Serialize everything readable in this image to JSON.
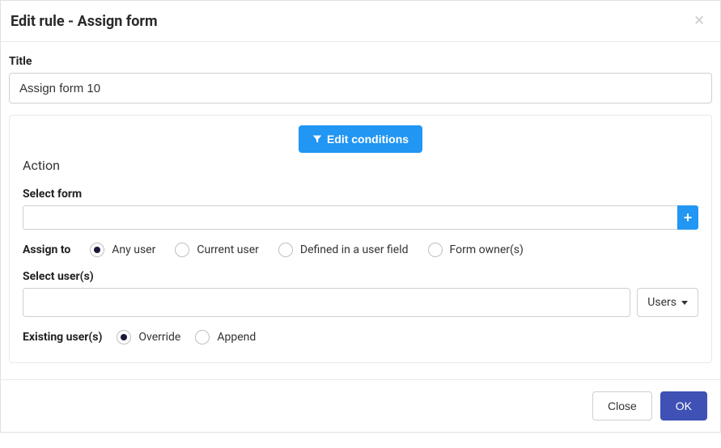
{
  "header": {
    "title": "Edit rule - Assign form"
  },
  "form": {
    "title_label": "Title",
    "title_value": "Assign form 10"
  },
  "action": {
    "edit_conditions_label": "Edit conditions",
    "section_label": "Action",
    "select_form_label": "Select form",
    "select_form_value": "",
    "assign_to_label": "Assign to",
    "assign_to_options": [
      {
        "label": "Any user",
        "checked": true
      },
      {
        "label": "Current user",
        "checked": false
      },
      {
        "label": "Defined in a user field",
        "checked": false
      },
      {
        "label": "Form owner(s)",
        "checked": false
      }
    ],
    "select_users_label": "Select user(s)",
    "select_users_value": "",
    "users_dropdown_label": "Users",
    "existing_users_label": "Existing user(s)",
    "existing_users_options": [
      {
        "label": "Override",
        "checked": true
      },
      {
        "label": "Append",
        "checked": false
      }
    ]
  },
  "footer": {
    "close_label": "Close",
    "ok_label": "OK"
  }
}
